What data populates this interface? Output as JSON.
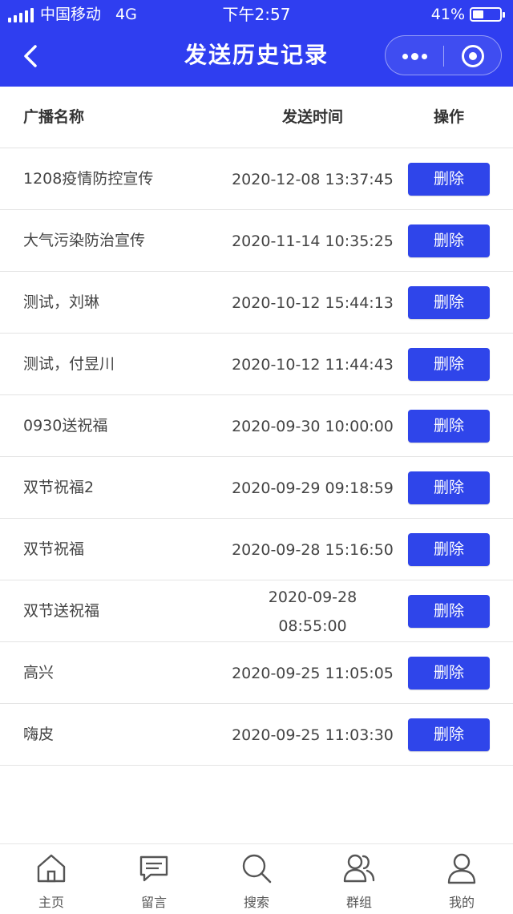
{
  "status_bar": {
    "carrier": "中国移动",
    "network": "4G",
    "time": "下午2:57",
    "battery_percent": "41%",
    "battery_level": 0.41
  },
  "header": {
    "title": "发送历史记录",
    "accent_color": "#2f3ef0"
  },
  "table": {
    "columns": {
      "name": "广播名称",
      "time": "发送时间",
      "operation": "操作"
    },
    "delete_label": "删除",
    "rows": [
      {
        "name": "1208疫情防控宣传",
        "time": [
          "2020-12-08 13:37:45"
        ]
      },
      {
        "name": "大气污染防治宣传",
        "time": [
          "2020-11-14 10:35:25"
        ]
      },
      {
        "name": "测试，刘琳",
        "time": [
          "2020-10-12 15:44:13"
        ]
      },
      {
        "name": "测试，付昱川",
        "time": [
          "2020-10-12 11:44:43"
        ]
      },
      {
        "name": "0930送祝福",
        "time": [
          "2020-09-30 10:00:00"
        ]
      },
      {
        "name": "双节祝福2",
        "time": [
          "2020-09-29 09:18:59"
        ]
      },
      {
        "name": "双节祝福",
        "time": [
          "2020-09-28 15:16:50"
        ]
      },
      {
        "name": "双节送祝福",
        "time": [
          "2020-09-28",
          "08:55:00"
        ]
      },
      {
        "name": "高兴",
        "time": [
          "2020-09-25 11:05:05"
        ]
      },
      {
        "name": "嗨皮",
        "time": [
          "2020-09-25 11:03:30"
        ]
      }
    ]
  },
  "tabbar": {
    "items": [
      {
        "label": "主页",
        "icon": "home-icon"
      },
      {
        "label": "留言",
        "icon": "message-icon"
      },
      {
        "label": "搜索",
        "icon": "search-icon"
      },
      {
        "label": "群组",
        "icon": "group-icon"
      },
      {
        "label": "我的",
        "icon": "user-icon"
      }
    ]
  }
}
